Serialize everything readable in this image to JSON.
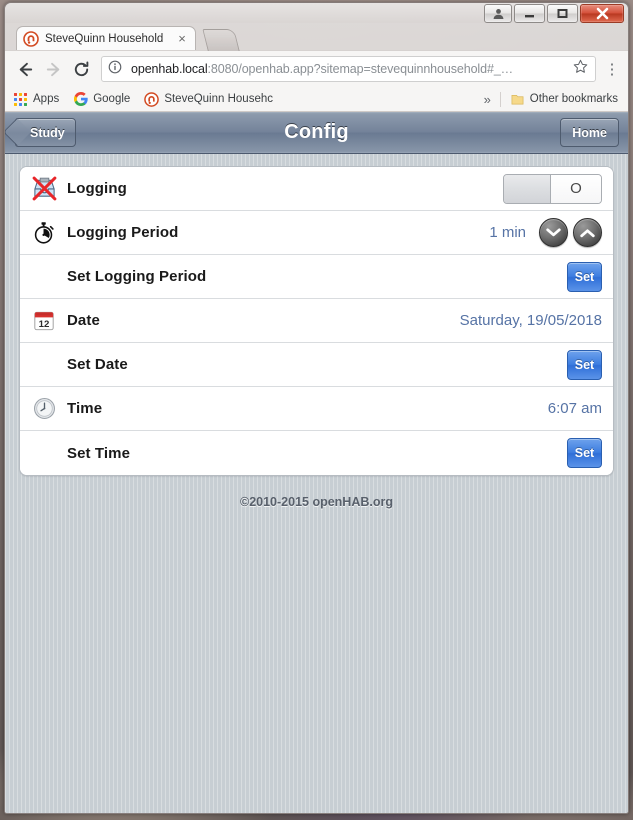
{
  "window": {
    "controls": {
      "person": "person-icon",
      "minimize": "minimize",
      "maximize": "maximize",
      "close": "close"
    }
  },
  "browser": {
    "tab": {
      "title": "SteveQuinn Household",
      "close_label": "×",
      "favicon": "openhab-favicon"
    },
    "new_tab_label": "",
    "nav": {
      "back": "←",
      "forward": "→",
      "reload": "C"
    },
    "omnibox": {
      "url_highlight": "openhab.local",
      "url_rest": ":8080/openhab.app?sitemap=stevequinnhousehold#_…",
      "info_icon": "info-circle-icon",
      "star_icon": "star-icon",
      "menu_icon": "kebab-menu-icon"
    },
    "bookmarks": {
      "apps_label": "Apps",
      "items": [
        {
          "label": "Google",
          "icon": "google-icon"
        },
        {
          "label": "SteveQuinn Househc",
          "icon": "openhab-favicon"
        }
      ],
      "overflow_label": "»",
      "other_label": "Other bookmarks",
      "other_icon": "folder-icon"
    }
  },
  "app": {
    "header": {
      "back_label": "Study",
      "title": "Config",
      "home_label": "Home"
    },
    "rows": [
      {
        "label": "Logging",
        "icon": "tray-disabled-icon",
        "control": "toggle",
        "toggle_state": "O"
      },
      {
        "label": "Logging Period",
        "icon": "stopwatch-icon",
        "control": "stepper",
        "value": "1 min",
        "down_icon": "chevron-down-icon",
        "up_icon": "chevron-up-icon"
      },
      {
        "label": "Set Logging Period",
        "icon": "",
        "control": "button",
        "button_label": "Set"
      },
      {
        "label": "Date",
        "icon": "calendar-icon",
        "icon_day": "12",
        "control": "text",
        "value": "Saturday, 19/05/2018"
      },
      {
        "label": "Set Date",
        "icon": "",
        "control": "button",
        "button_label": "Set"
      },
      {
        "label": "Time",
        "icon": "clock-icon",
        "control": "text",
        "value": "6:07 am"
      },
      {
        "label": "Set Time",
        "icon": "",
        "control": "button",
        "button_label": "Set"
      }
    ],
    "footer": "©2010-2015 openHAB.org"
  },
  "colors": {
    "accent_blue": "#3d7de0",
    "value_blue": "#5673a5",
    "page_bg": "#c7ced3",
    "header_bg": "#74839a"
  }
}
